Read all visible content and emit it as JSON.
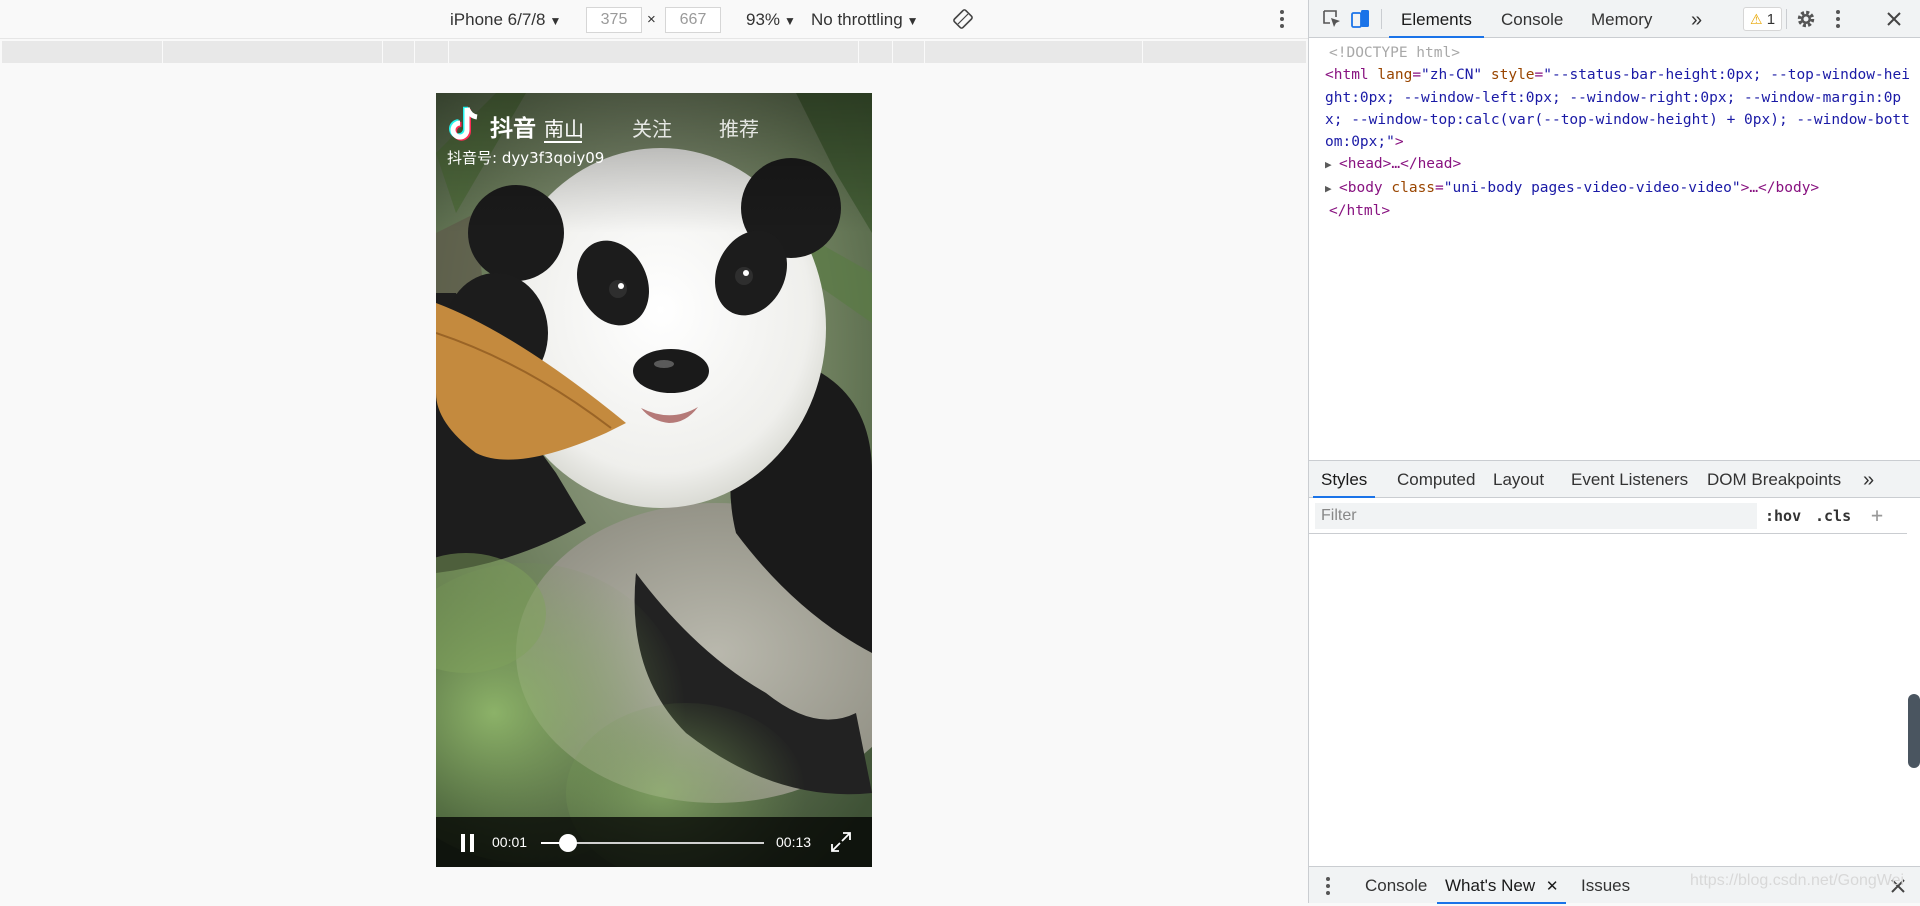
{
  "emulation": {
    "device": "iPhone 6/7/8",
    "width": "375",
    "height": "667",
    "times": "×",
    "zoom": "93%",
    "throttling": "No throttling"
  },
  "phone": {
    "brand": "抖音",
    "account": "抖音号: dyy3f3qoiy09",
    "tabs": [
      "南山",
      "关注",
      "推荐"
    ],
    "active_tab": 0,
    "player": {
      "current_time": "00:01",
      "total_time": "00:13",
      "progress": 0.12
    }
  },
  "devtools": {
    "tabs": [
      "Elements",
      "Console",
      "Memory"
    ],
    "active_tab": "Elements",
    "more": "»",
    "warnings": "1",
    "dom": {
      "doctype": "<!DOCTYPE html>",
      "html_open": "<html",
      "lang_attr": "lang",
      "lang_val": "\"zh-CN\"",
      "style_attr": "style",
      "style_val": "\"--status-bar-height:0px; --top-window-height:0px; --window-left:0px; --window-right:0px; --window-margin:0px; --window-top:calc(var(--top-window-height) + 0px); --window-bottom:0px;\"",
      "html_close_bracket": ">",
      "head": "<head>…</head>",
      "body_open": "<body",
      "class_attr": "class",
      "class_val": "\"uni-body pages-video-video-video\"",
      "body_rest": ">…</body>",
      "html_end": "</html>"
    },
    "styles_tabs": [
      "Styles",
      "Computed",
      "Layout",
      "Event Listeners",
      "DOM Breakpoints"
    ],
    "filter_placeholder": "Filter",
    "hov": ":hov",
    "cls": ".cls",
    "drawer_tabs": [
      "Console",
      "What's New",
      "Issues"
    ],
    "watermark": "https://blog.csdn.net/GongWei"
  }
}
